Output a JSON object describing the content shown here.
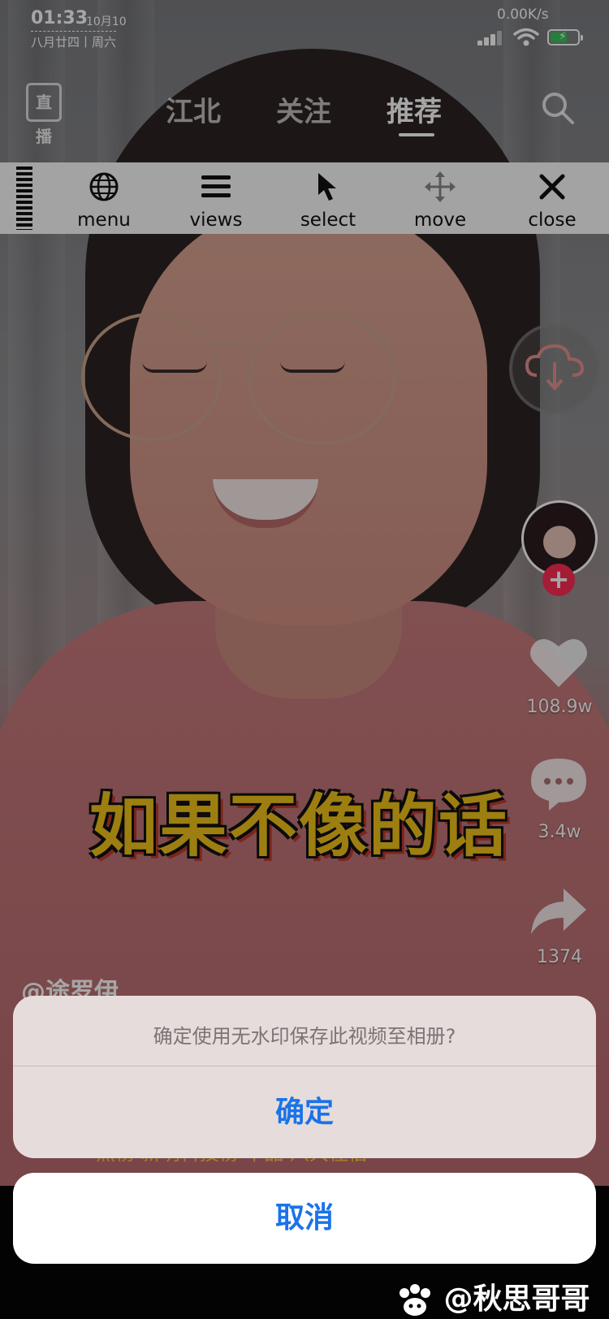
{
  "status_bar": {
    "time": "01:33",
    "date": "10月10",
    "lunar_date": "八月廿四丨周六",
    "net_speed": "0.00K/s",
    "battery_color": "#34c759"
  },
  "top_nav": {
    "live_label": "直播",
    "tabs": [
      {
        "label": "江北",
        "active": false
      },
      {
        "label": "关注",
        "active": false
      },
      {
        "label": "推荐",
        "active": true
      }
    ]
  },
  "toolbar": {
    "items": [
      {
        "label": "menu",
        "icon": "globe-icon"
      },
      {
        "label": "views",
        "icon": "hamburger-icon"
      },
      {
        "label": "select",
        "icon": "cursor-icon"
      },
      {
        "label": "move",
        "icon": "move-arrows-icon"
      },
      {
        "label": "close",
        "icon": "close-icon"
      }
    ]
  },
  "right_rail": {
    "like_count": "108.9w",
    "comment_count": "3.4w",
    "share_count": "1374",
    "follow_color": "#fe2c55"
  },
  "video": {
    "subtitle": "如果不像的话",
    "author": "@途罗伊",
    "music_text": "热榜·新明科技榜·单品·八大住宿"
  },
  "dialog": {
    "message": "确定使用无水印保存此视频至相册?",
    "confirm_label": "确定",
    "cancel_label": "取消",
    "accent_color": "#1a73e8"
  },
  "watermark": {
    "text": "@秋思哥哥"
  }
}
